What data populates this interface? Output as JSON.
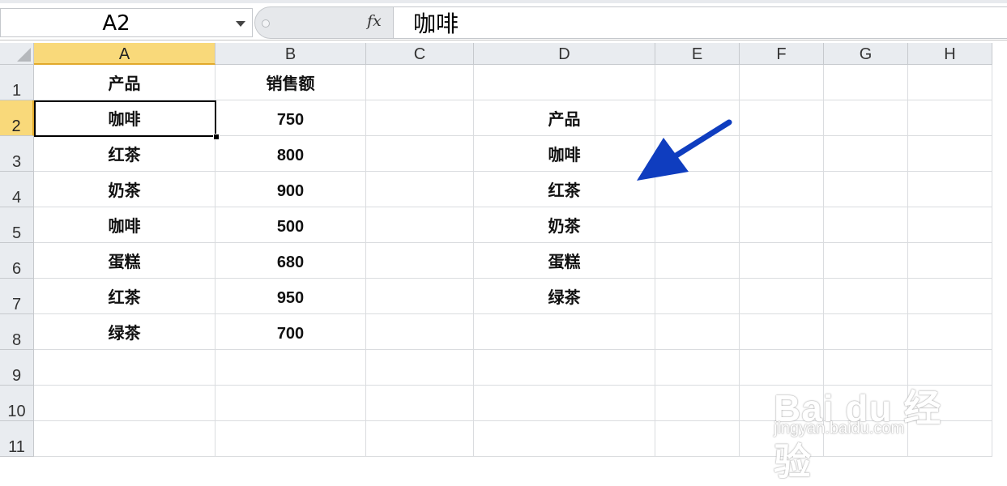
{
  "name_box": {
    "value": "A2"
  },
  "formula_bar": {
    "fx_label": "fx",
    "content": "咖啡"
  },
  "columns": [
    "A",
    "B",
    "C",
    "D",
    "E",
    "F",
    "G",
    "H"
  ],
  "rows": [
    "1",
    "2",
    "3",
    "4",
    "5",
    "6",
    "7",
    "8",
    "9",
    "10",
    "11"
  ],
  "cells": {
    "A1": "产品",
    "B1": "销售额",
    "A2": "咖啡",
    "B2": "750",
    "D2": "产品",
    "A3": "红茶",
    "B3": "800",
    "D3": "咖啡",
    "A4": "奶茶",
    "B4": "900",
    "D4": "红茶",
    "A5": "咖啡",
    "B5": "500",
    "D5": "奶茶",
    "A6": "蛋糕",
    "B6": "680",
    "D6": "蛋糕",
    "A7": "红茶",
    "B7": "950",
    "D7": "绿茶",
    "A8": "绿茶",
    "B8": "700"
  },
  "selection": {
    "active_cell": "A2",
    "active_column": "A",
    "active_row": "2"
  },
  "annotation": {
    "arrow_color": "#0f3dbf"
  },
  "watermark": {
    "logo": "Bai du 经验",
    "url": "jingyan.baidu.com"
  }
}
